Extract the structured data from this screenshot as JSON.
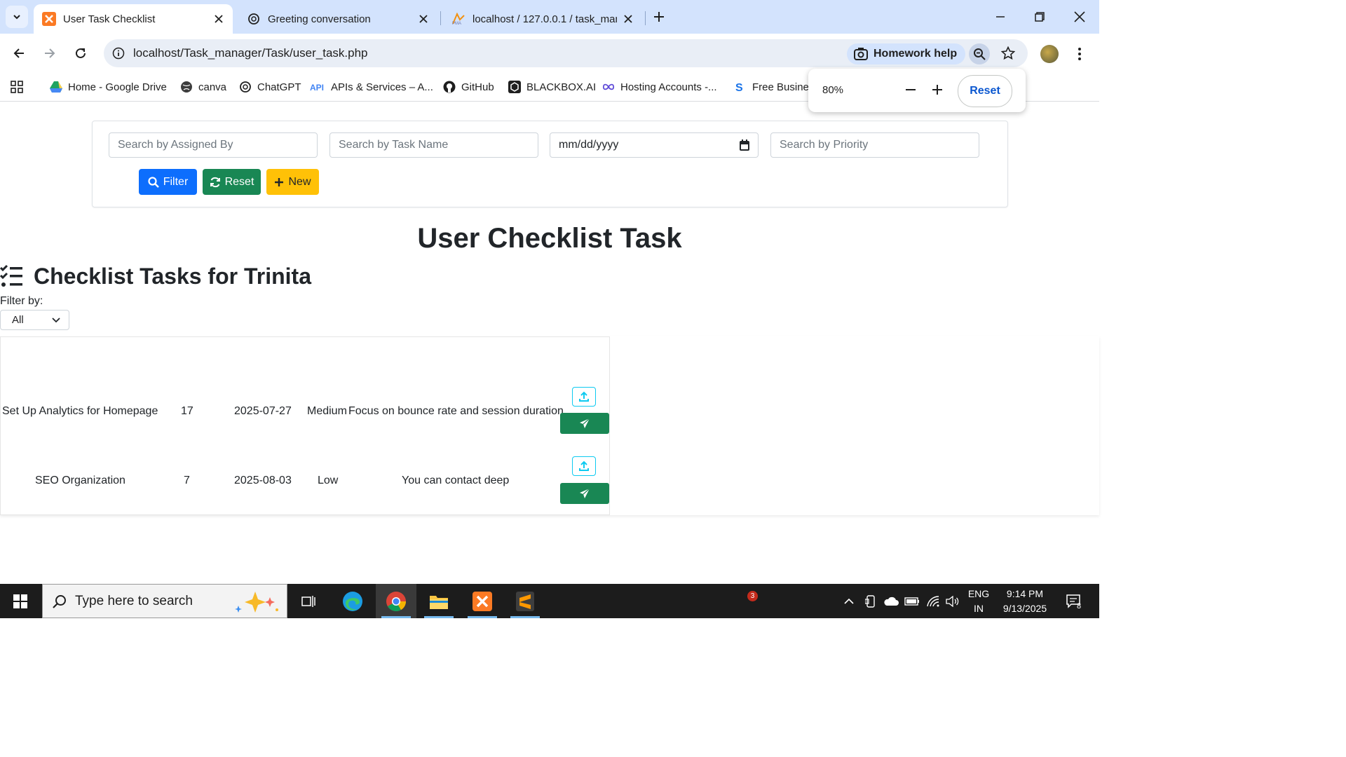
{
  "browser": {
    "tabs": [
      {
        "title": "User Task Checklist",
        "active": true
      },
      {
        "title": "Greeting conversation",
        "active": false
      },
      {
        "title": "localhost / 127.0.0.1 / task_man",
        "active": false
      }
    ],
    "url": "localhost/Task_manager/Task/user_task.php",
    "homework_help": "Homework help",
    "bookmarks": [
      "Home - Google Drive",
      "canva",
      "ChatGPT",
      "APIs & Services – A...",
      "GitHub",
      "BLACKBOX.AI",
      "Hosting Accounts -...",
      "Free Busines"
    ],
    "zoom_popup": {
      "level": "80%",
      "reset_label": "Reset"
    }
  },
  "filters": {
    "assigned_by_placeholder": "Search by Assigned By",
    "task_name_placeholder": "Search by Task Name",
    "date_placeholder": "mm/dd/yyyy",
    "priority_placeholder": "Search by Priority",
    "filter_button": "Filter",
    "reset_button": "Reset",
    "new_button": "New"
  },
  "page": {
    "title": "User Checklist Task",
    "section_title": "Checklist Tasks for Trinita",
    "filter_by_label": "Filter by:",
    "filter_by_value": "All"
  },
  "tasks": [
    {
      "name": "Set Up Analytics for Homepage",
      "count": "17",
      "date": "2025-07-27",
      "priority": "Medium",
      "note": "Focus on bounce rate and session duration."
    },
    {
      "name": "SEO Organization",
      "count": "7",
      "date": "2025-08-03",
      "priority": "Low",
      "note": "You can contact deep"
    }
  ],
  "taskbar": {
    "search_placeholder": "Type here to search",
    "notification_count": "3",
    "language": "ENG",
    "region": "IN",
    "time": "9:14 PM",
    "date": "9/13/2025",
    "action_center_count": "8"
  },
  "colors": {
    "tab_strip": "#d3e3fd",
    "primary": "#0d6efd",
    "success": "#198754",
    "warning": "#ffc107",
    "info": "#0dcaf0"
  }
}
